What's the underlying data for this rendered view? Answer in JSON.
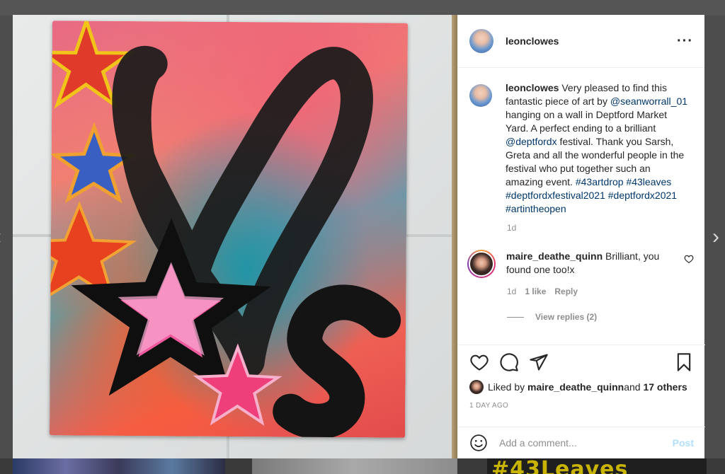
{
  "post": {
    "username": "leonclowes",
    "more_icon": "more-horizontal-icon",
    "caption": {
      "username": "leonclowes",
      "text_1": " Very pleased to find this fantastic piece of art by ",
      "mention_1": "@seanworrall_01",
      "text_2": " hanging on a wall in Deptford Market Yard. A perfect ending to a brilliant ",
      "mention_2": "@deptfordx",
      "text_3": " festival. Thank you Sarsh, Greta and all the wonderful people in the festival who put together such an amazing event. ",
      "hashtags": "#43artdrop #43leaves #deptfordxfestival2021 #deptfordx2021 #artintheopen",
      "time": "1d"
    },
    "comment": {
      "username": "maire_deathe_quinn",
      "text": " Brilliant, you found one too!x",
      "time": "1d",
      "likes": "1 like",
      "reply": "Reply",
      "view_replies": "View replies (2)"
    },
    "liked_by": {
      "prefix": "Liked by ",
      "user": "maire_deathe_quinn",
      "middle": " and ",
      "others": "17 others"
    },
    "timestamp": "1 DAY AGO",
    "add_comment_placeholder": "Add a comment...",
    "post_button": "Post"
  },
  "navigation": {
    "prev": "‹",
    "next": "›"
  },
  "background_thumb_text": "#43Leaves",
  "colors": {
    "link": "#00376b",
    "muted": "#8e8e8e",
    "post_disabled": "#b2dffc"
  }
}
